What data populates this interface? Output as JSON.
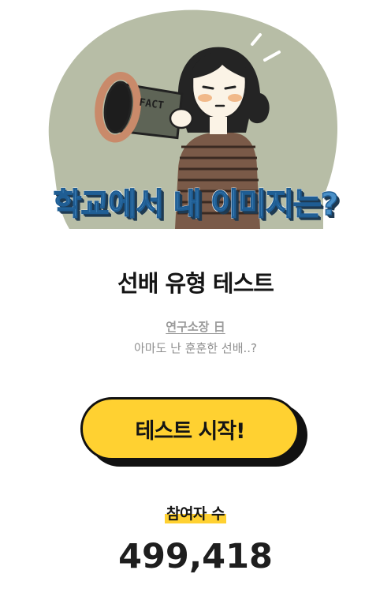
{
  "hero": {
    "headline": "학교에서 내 이미지는?",
    "megaphone_text": "FACT"
  },
  "test": {
    "title": "선배 유형 테스트",
    "author": "연구소장 日",
    "description": "아마도 난 훈훈한 선배..?"
  },
  "actions": {
    "start_label": "테스트 시작!"
  },
  "stats": {
    "participants_label": "참여자 수",
    "participants_count": "499,418"
  },
  "colors": {
    "accent_yellow": "#ffd131",
    "headline_blue": "#4a90c8",
    "blob_green": "#b7bda6"
  }
}
